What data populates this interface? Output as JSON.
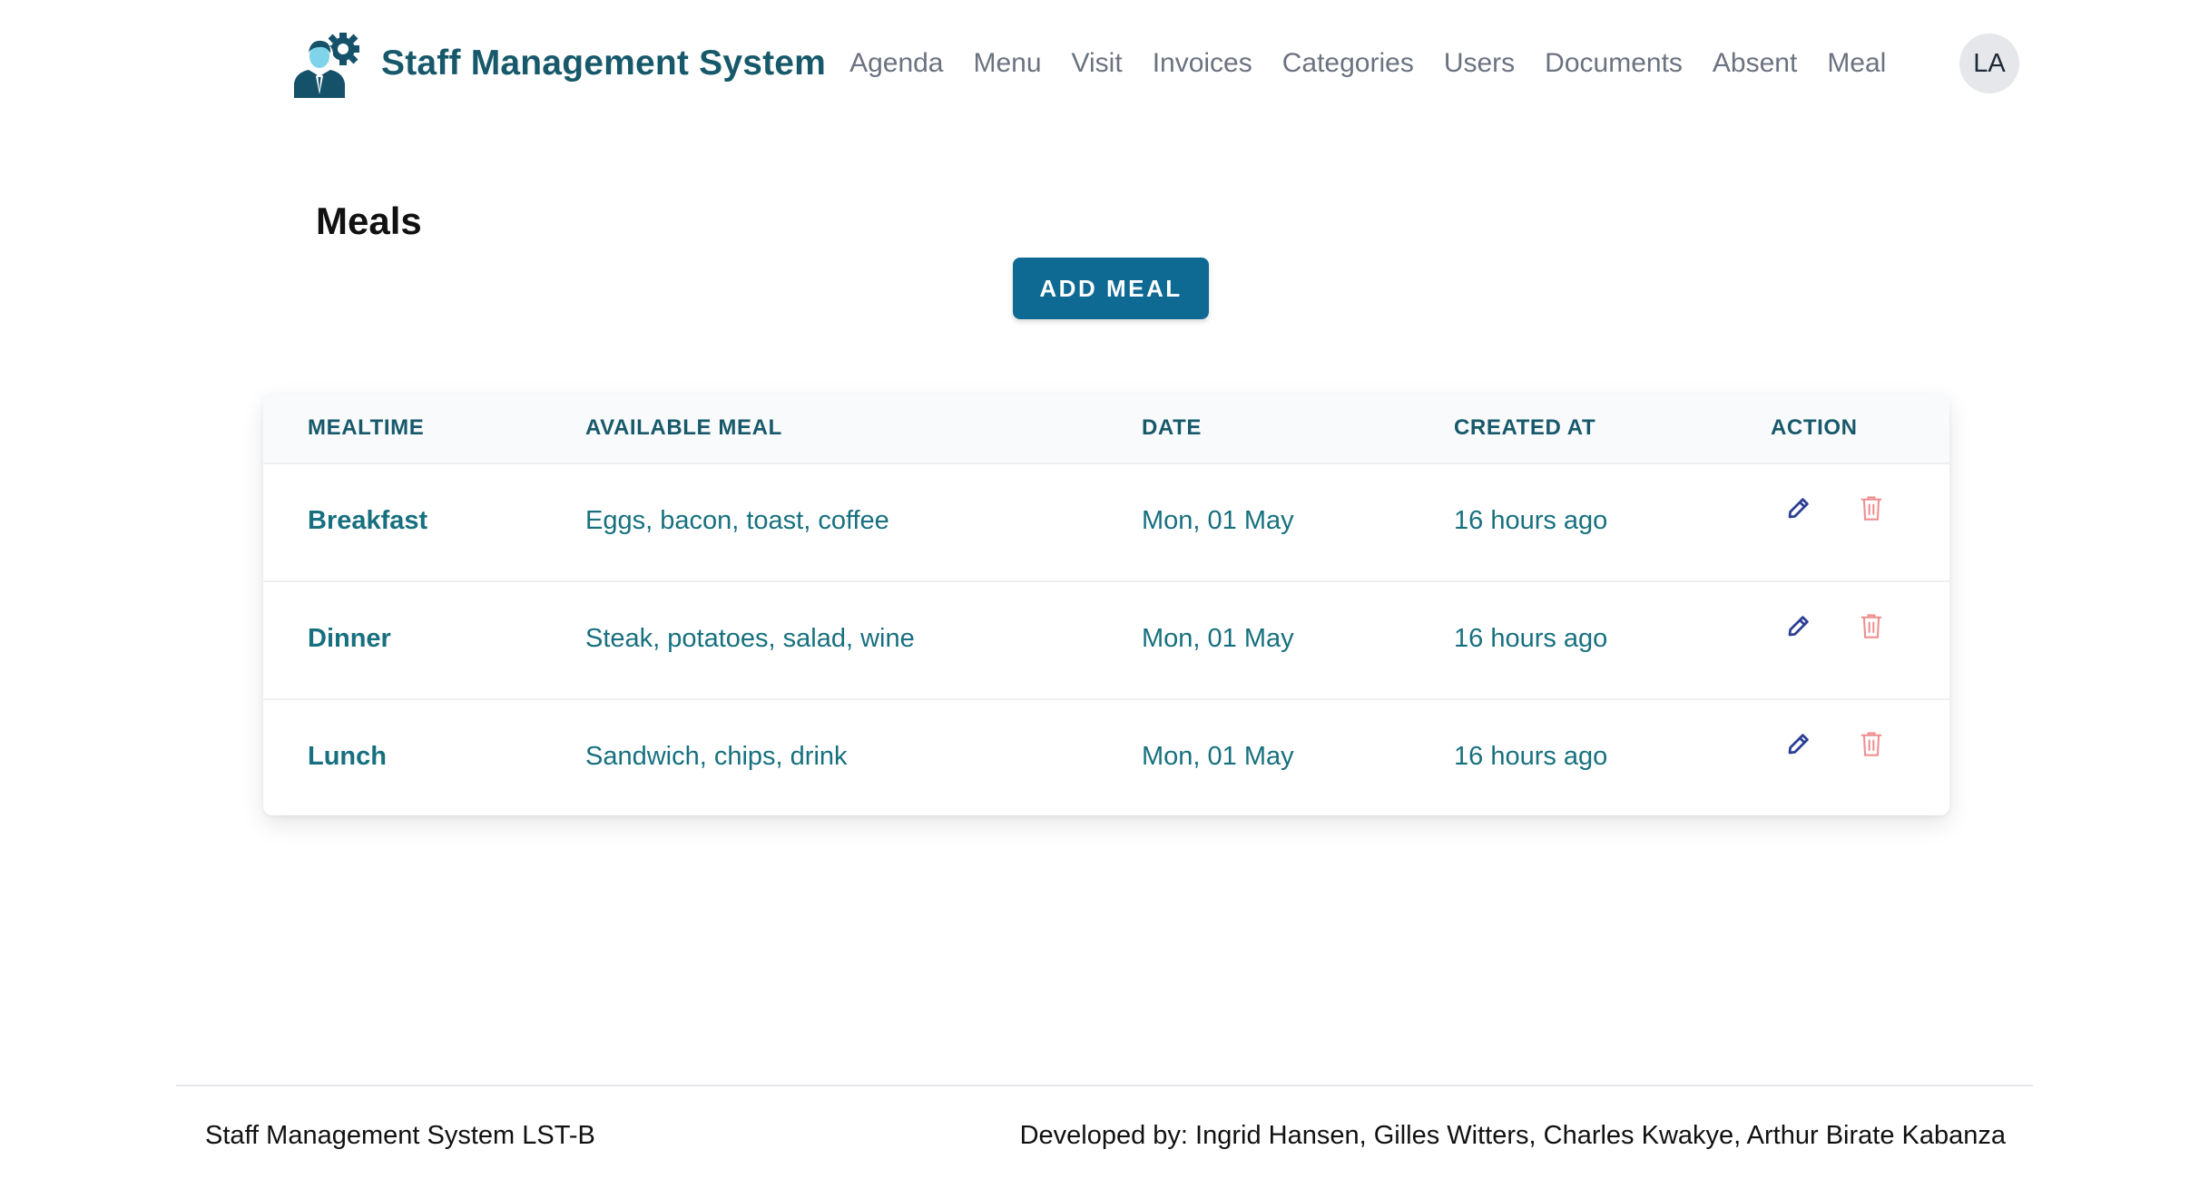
{
  "header": {
    "brand_title": "Staff Management System",
    "nav": [
      "Agenda",
      "Menu",
      "Visit",
      "Invoices",
      "Categories",
      "Users",
      "Documents",
      "Absent",
      "Meal"
    ],
    "avatar_initials": "LA"
  },
  "main": {
    "page_title": "Meals",
    "add_button_label": "ADD MEAL",
    "table": {
      "headers": [
        "MEALTIME",
        "AVAILABLE MEAL",
        "DATE",
        "CREATED AT",
        "ACTION"
      ],
      "rows": [
        {
          "mealtime": "Breakfast",
          "meal": "Eggs, bacon, toast, coffee",
          "date": "Mon, 01 May",
          "created": "16 hours ago"
        },
        {
          "mealtime": "Dinner",
          "meal": "Steak, potatoes, salad, wine",
          "date": "Mon, 01 May",
          "created": "16 hours ago"
        },
        {
          "mealtime": "Lunch",
          "meal": "Sandwich, chips, drink",
          "date": "Mon, 01 May",
          "created": "16 hours ago"
        }
      ],
      "row_actions": [
        "pencil-icon",
        "trash-icon"
      ]
    }
  },
  "footer": {
    "left": "Staff Management System LST-B",
    "right": "Developed by: Ingrid Hansen, Gilles Witters, Charles Kwakye, Arthur Birate Kabanza"
  },
  "colors": {
    "brand": "#17596b",
    "button": "#0e6a92",
    "row_text": "#17707f",
    "edit_icon": "#2b3f94",
    "delete_icon": "#ef8f8f"
  }
}
